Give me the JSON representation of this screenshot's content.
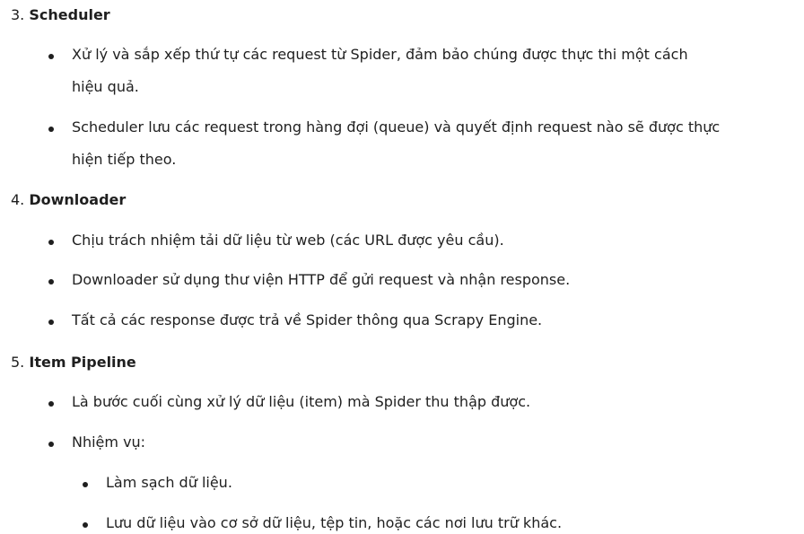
{
  "sections": [
    {
      "number": "3.",
      "title": "Scheduler",
      "items": [
        {
          "lines": [
            "Xử lý và sắp xếp thứ tự các request từ Spider, đảm bảo chúng được thực thi một cách",
            "hiệu quả."
          ]
        },
        {
          "lines": [
            "Scheduler lưu các request trong hàng đợi (queue) và quyết định request nào sẽ được thực",
            "hiện tiếp theo."
          ]
        }
      ]
    },
    {
      "number": "4.",
      "title": "Downloader",
      "items": [
        {
          "lines": [
            "Chịu trách nhiệm tải dữ liệu từ web (các URL được yêu cầu)."
          ]
        },
        {
          "lines": [
            "Downloader sử dụng thư viện HTTP để gửi request và nhận response."
          ]
        },
        {
          "lines": [
            "Tất cả các response được trả về Spider thông qua Scrapy Engine."
          ]
        }
      ]
    },
    {
      "number": "5.",
      "title": "Item Pipeline",
      "items": [
        {
          "lines": [
            "Là bước cuối cùng xử lý dữ liệu (item) mà Spider thu thập được."
          ]
        },
        {
          "lines": [
            "Nhiệm vụ:"
          ],
          "subitems": [
            "Làm sạch dữ liệu.",
            "Lưu dữ liệu vào cơ sở dữ liệu, tệp tin, hoặc các nơi lưu trữ khác."
          ]
        }
      ]
    }
  ]
}
